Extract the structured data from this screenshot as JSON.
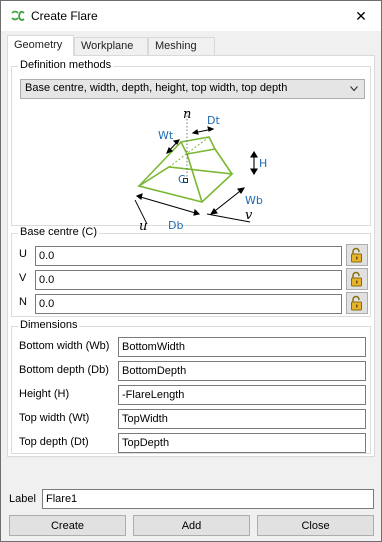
{
  "window": {
    "title": "Create Flare",
    "close_glyph": "✕"
  },
  "tabs": [
    {
      "label": "Geometry",
      "active": true
    },
    {
      "label": "Workplane",
      "active": false
    },
    {
      "label": "Meshing",
      "active": false
    }
  ],
  "definition": {
    "legend": "Definition methods",
    "selected": "Base centre, width, depth, height, top width, top depth",
    "diagram_labels": {
      "n": "n",
      "dt": "Dt",
      "wt": "Wt",
      "h": "H",
      "c": "C",
      "wb": "Wb",
      "db": "Db",
      "u": "u",
      "v": "v"
    },
    "accent_color": "#7ab833",
    "label_color": "#1e6ab0"
  },
  "base_centre": {
    "legend": "Base centre (C)",
    "fields": [
      {
        "label": "U",
        "value": "0.0",
        "lock_icon": "unlocked-padlock-icon"
      },
      {
        "label": "V",
        "value": "0.0",
        "lock_icon": "unlocked-padlock-icon"
      },
      {
        "label": "N",
        "value": "0.0",
        "lock_icon": "unlocked-padlock-icon"
      }
    ]
  },
  "dimensions": {
    "legend": "Dimensions",
    "fields": [
      {
        "label": "Bottom width (Wb)",
        "value": "BottomWidth"
      },
      {
        "label": "Bottom depth (Db)",
        "value": "BottomDepth"
      },
      {
        "label": "Height (H)",
        "value": "-FlareLength"
      },
      {
        "label": "Top width (Wt)",
        "value": "TopWidth"
      },
      {
        "label": "Top depth (Dt)",
        "value": "TopDepth"
      }
    ]
  },
  "label_field": {
    "label": "Label",
    "value": "Flare1"
  },
  "buttons": {
    "create": "Create",
    "add": "Add",
    "close": "Close"
  }
}
